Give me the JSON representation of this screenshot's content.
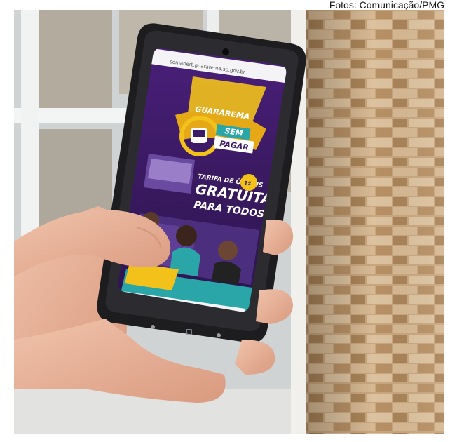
{
  "caption": {
    "credit": "Fotos: Comunicação/PMG"
  },
  "phone_screen": {
    "url_text": "semabert.guararema.sp.gov.br",
    "logo_top": "GUARAREMA",
    "logo_sem": "SEM",
    "logo_pagar": "PAGAR",
    "headline_small": "TARIFA DE ÔNIBUS",
    "headline_big": "GRATUITA",
    "headline_sub": "PARA TODOS",
    "stamp": "1º"
  },
  "colors": {
    "screen_purple": "#3c1a66",
    "accent_yellow": "#f2c21b",
    "teal": "#2aa6a8",
    "phone_body": "#1d1d20",
    "skin": "#e8b39a"
  }
}
